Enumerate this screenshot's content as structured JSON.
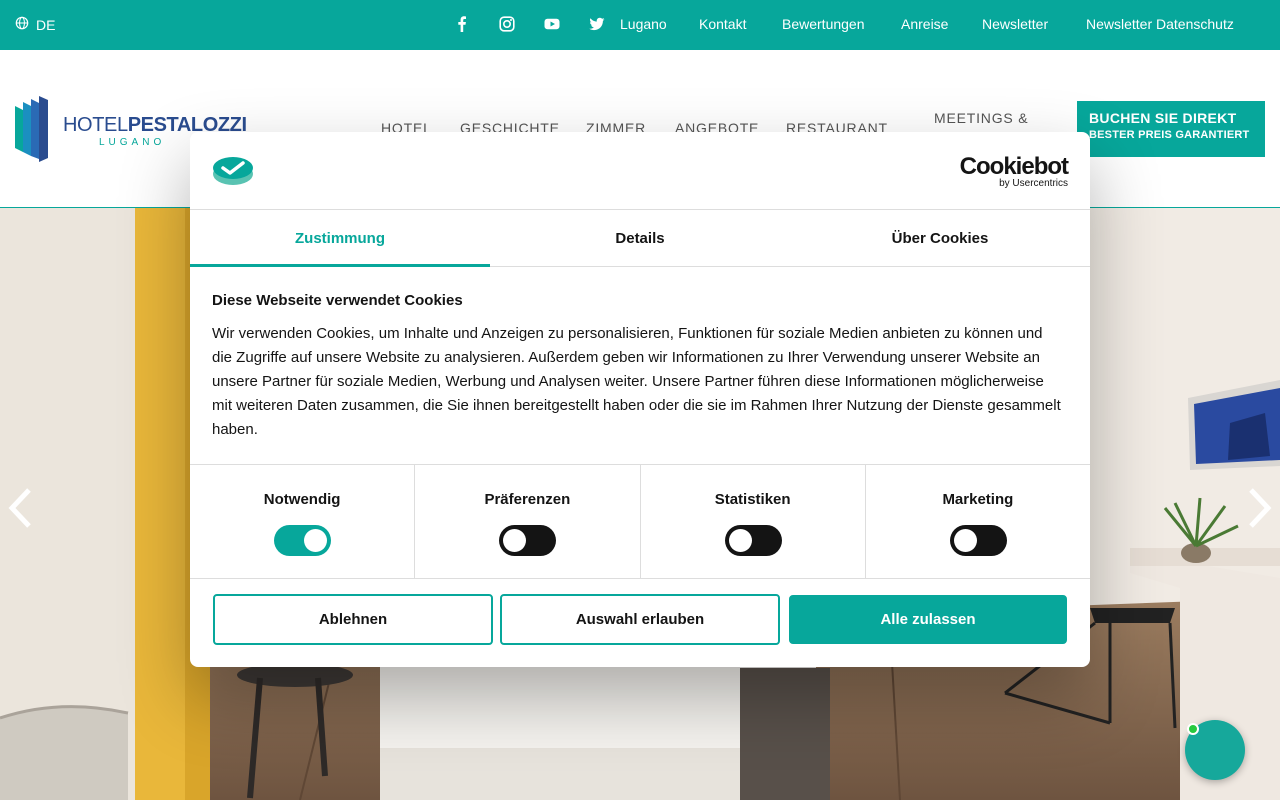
{
  "topbar": {
    "language": "DE",
    "social_icons": [
      "facebook-icon",
      "instagram-icon",
      "youtube-icon",
      "twitter-icon"
    ],
    "links": [
      "Lugano",
      "Kontakt",
      "Bewertungen",
      "Anreise",
      "Newsletter",
      "Newsletter Datenschutz"
    ]
  },
  "header": {
    "logo": {
      "name_thin": "HOTEL",
      "name_bold": "PESTALOZZI",
      "city": "LUGANO"
    },
    "nav": [
      "HOTEL",
      "GESCHICHTE",
      "ZIMMER",
      "ANGEBOTE",
      "RESTAURANT",
      "MEETINGS &"
    ],
    "book_button": {
      "label": "BUCHEN SIE DIREKT",
      "sub": "BESTER PREIS GARANTIERT"
    }
  },
  "hero": {
    "prev_icon": "chevron-left-icon",
    "next_icon": "chevron-right-icon"
  },
  "chat": {
    "icon": "chat-icon",
    "status_color": "#27c93f"
  },
  "cookie_dialog": {
    "brand": {
      "name": "Cookiebot",
      "by": "by Usercentrics"
    },
    "tabs": [
      "Zustimmung",
      "Details",
      "Über Cookies"
    ],
    "active_tab": "Zustimmung",
    "title": "Diese Webseite verwendet Cookies",
    "text": "Wir verwenden Cookies, um Inhalte und Anzeigen zu personalisieren, Funktionen für soziale Medien anbieten zu können und die Zugriffe auf unsere Website zu analysieren. Außerdem geben wir Informationen zu Ihrer Verwendung unserer Website an unsere Partner für soziale Medien, Werbung und Analysen weiter. Unsere Partner führen diese Informationen möglicherweise mit weiteren Daten zusammen, die Sie ihnen bereitgestellt haben oder die sie im Rahmen Ihrer Nutzung der Dienste gesammelt haben.",
    "categories": [
      {
        "label": "Notwendig",
        "enabled": true
      },
      {
        "label": "Präferenzen",
        "enabled": false
      },
      {
        "label": "Statistiken",
        "enabled": false
      },
      {
        "label": "Marketing",
        "enabled": false
      }
    ],
    "buttons": {
      "deny": "Ablehnen",
      "allow_selection": "Auswahl erlauben",
      "allow_all": "Alle zulassen"
    }
  },
  "colors": {
    "accent": "#07a79b",
    "dark": "#141414",
    "logo_blue": "#2a4c8f"
  }
}
